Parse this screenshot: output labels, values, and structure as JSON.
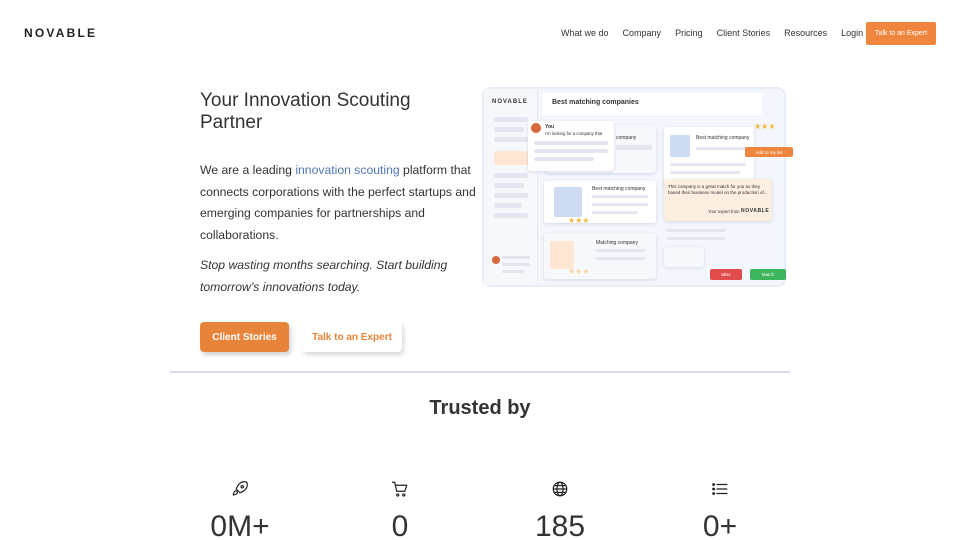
{
  "brand": {
    "logo": "NOVABLE",
    "accent": "#f0863d",
    "link_color": "#4f77b5"
  },
  "nav": {
    "items": [
      "What we do",
      "Company",
      "Pricing",
      "Client Stories",
      "Resources",
      "Login"
    ],
    "cta": "Talk to an Expert"
  },
  "hero": {
    "title": "Your Innovation Scouting Partner",
    "desc_pre": "We are a leading ",
    "desc_link": "innovation scouting",
    "desc_post": " platform that connects corporations with the perfect startups and emerging companies for partnerships and collaborations.",
    "italic": "Stop wasting months searching. Start building tomorrow’s innovations today.",
    "btn_primary": "Client Stories",
    "btn_secondary": "Talk to an Expert"
  },
  "mockup": {
    "logo": "NOVABLE",
    "header": "Best matching companies",
    "chat_user": "You",
    "chat_msg": "I'm looking for a company that",
    "card_best_1": "Best matching company",
    "card_best_2": "Best matching company",
    "card_best_3": "Matching company",
    "card_bg": "company",
    "add_to_list": "Add to my list",
    "expert_msg": "This company is a great match for you as they based their business model on the production of...",
    "expert_from": "Your expert from",
    "expert_logo": "NOVABLE",
    "btn_miss": "Miss",
    "btn_match": "Match"
  },
  "trusted": {
    "heading": "Trusted by"
  },
  "stats": [
    {
      "icon": "rocket-icon",
      "value": "0M+"
    },
    {
      "icon": "cart-icon",
      "value": "0"
    },
    {
      "icon": "globe-icon",
      "value": "185"
    },
    {
      "icon": "list-icon",
      "value": "0+"
    }
  ]
}
